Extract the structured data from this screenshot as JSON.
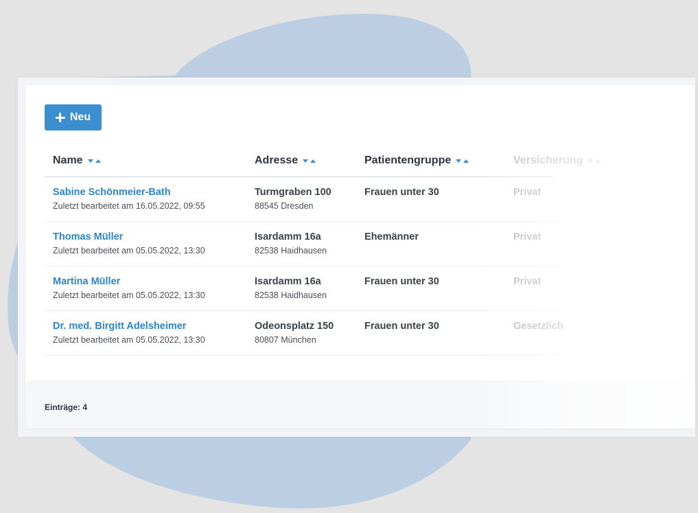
{
  "toolbar": {
    "new_label": "Neu"
  },
  "table": {
    "columns": [
      {
        "label": "Name"
      },
      {
        "label": "Adresse"
      },
      {
        "label": "Patientengruppe"
      },
      {
        "label": "Versicherung"
      }
    ],
    "rows": [
      {
        "name": "Sabine Schönmeier-Bath",
        "edited": "Zuletzt bearbeitet am 16.05.2022, 09:55",
        "street": "Turmgraben 100",
        "city": "88545 Dresden",
        "group": "Frauen unter 30",
        "insurance": "Privat"
      },
      {
        "name": "Thomas Müller",
        "edited": "Zuletzt bearbeitet am 05.05.2022, 13:30",
        "street": "Isardamm 16a",
        "city": "82538 Haidhausen",
        "group": "Ehemänner",
        "insurance": "Privat"
      },
      {
        "name": "Martina Müller",
        "edited": "Zuletzt bearbeitet am 05.05.2022, 13:30",
        "street": "Isardamm 16a",
        "city": "82538 Haidhausen",
        "group": "Frauen unter 30",
        "insurance": "Privat"
      },
      {
        "name": "Dr. med. Birgitt Adelsheimer",
        "edited": "Zuletzt bearbeitet am 05.05.2022, 13:30",
        "street": "Odeonsplatz 150",
        "city": "80807 München",
        "group": "Frauen unter 30",
        "insurance": "Gesetzlich"
      }
    ]
  },
  "footer": {
    "entries": "Einträge: 4"
  },
  "colors": {
    "accent": "#3b8fd0",
    "link": "#2d85c7",
    "blob": "#bccfe2",
    "background": "#e4e4e4"
  }
}
